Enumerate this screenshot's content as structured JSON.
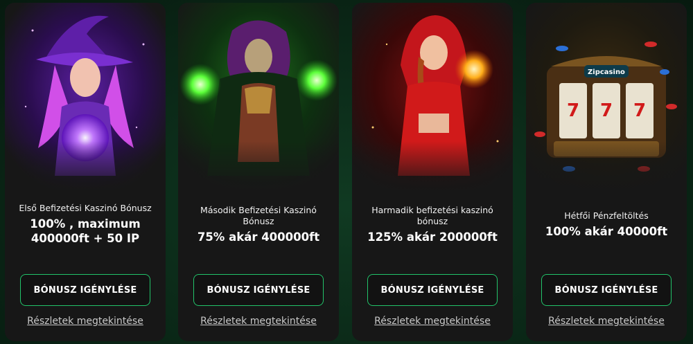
{
  "cards": [
    {
      "subtitle": "Első Befizetési Kaszinó Bónusz",
      "headline": "100% , maximum 400000ft + 50 IP",
      "button_label": "BÓNUSZ IGÉNYLÉSE",
      "link_label": "Részletek megtekintése",
      "theme_color": "#9b3df0"
    },
    {
      "subtitle": "Második Befizetési Kaszinó Bónusz",
      "headline": "75% akár 400000ft",
      "button_label": "BÓNUSZ IGÉNYLÉSE",
      "link_label": "Részletek megtekintése",
      "theme_color": "#2fe04a"
    },
    {
      "subtitle": "Harmadik befizetési kaszinó bónusz",
      "headline": "125% akár 200000ft",
      "button_label": "BÓNUSZ IGÉNYLÉSE",
      "link_label": "Részletek megtekintése",
      "theme_color": "#e02424"
    },
    {
      "subtitle": "Hétfői Pénzfeltöltés",
      "headline": "100% akár 40000ft",
      "button_label": "BÓNUSZ IGÉNYLÉSE",
      "link_label": "Részletek megtekintése",
      "theme_color": "#d9a441",
      "logo_text": "Zipcasino",
      "reel_symbols": [
        "7",
        "7",
        "7"
      ]
    }
  ],
  "colors": {
    "accent": "#22c46a",
    "card_bg": "#171717",
    "page_bg": "#0a2616"
  }
}
